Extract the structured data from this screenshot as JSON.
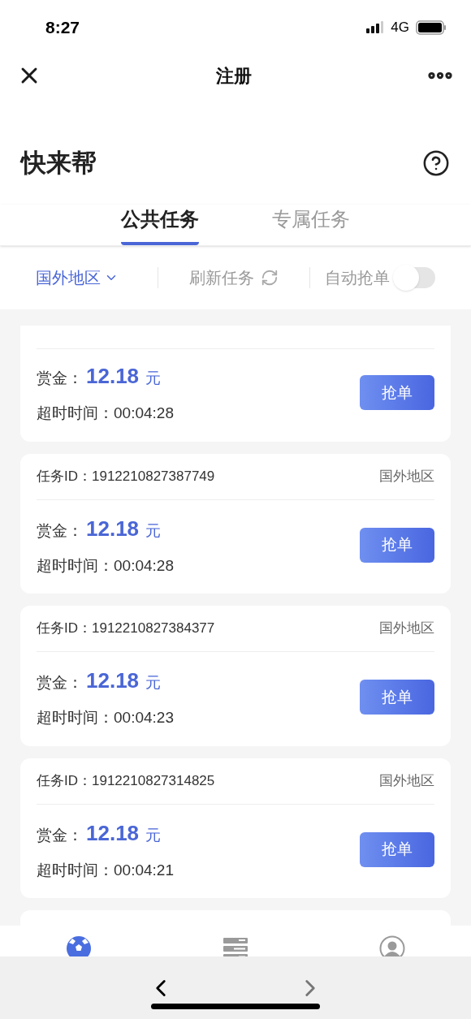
{
  "status_bar": {
    "time": "8:27",
    "network": "4G"
  },
  "nav": {
    "title": "注册"
  },
  "header": {
    "app_name": "快来帮"
  },
  "tabs": [
    {
      "label": "公共任务",
      "selected": true
    },
    {
      "label": "专属任务",
      "selected": false
    }
  ],
  "filters": {
    "region": "国外地区",
    "refresh": "刷新任务",
    "auto_grab": {
      "label": "自动抢单",
      "on": false
    }
  },
  "tasks": [
    {
      "kind": "cut_top",
      "reward_label": "赏金：",
      "reward": "12.18",
      "unit": "元",
      "timeout_label": "超时时间：",
      "timeout": "00:04:28",
      "button": "抢单"
    },
    {
      "kind": "full",
      "id_label": "任务ID：",
      "id": "1912210827387749",
      "region": "国外地区",
      "reward_label": "赏金：",
      "reward": "12.18",
      "unit": "元",
      "timeout_label": "超时时间：",
      "timeout": "00:04:28",
      "button": "抢单"
    },
    {
      "kind": "full",
      "id_label": "任务ID：",
      "id": "1912210827384377",
      "region": "国外地区",
      "reward_label": "赏金：",
      "reward": "12.18",
      "unit": "元",
      "timeout_label": "超时时间：",
      "timeout": "00:04:23",
      "button": "抢单"
    },
    {
      "kind": "full",
      "id_label": "任务ID：",
      "id": "1912210827314825",
      "region": "国外地区",
      "reward_label": "赏金：",
      "reward": "12.18",
      "unit": "元",
      "timeout_label": "超时时间：",
      "timeout": "00:04:21",
      "button": "抢单"
    },
    {
      "kind": "cut_bottom"
    }
  ],
  "bottom_tabs": [
    {
      "kind": "ball",
      "selected": true
    },
    {
      "kind": "list",
      "selected": false
    },
    {
      "kind": "user",
      "selected": false
    }
  ]
}
